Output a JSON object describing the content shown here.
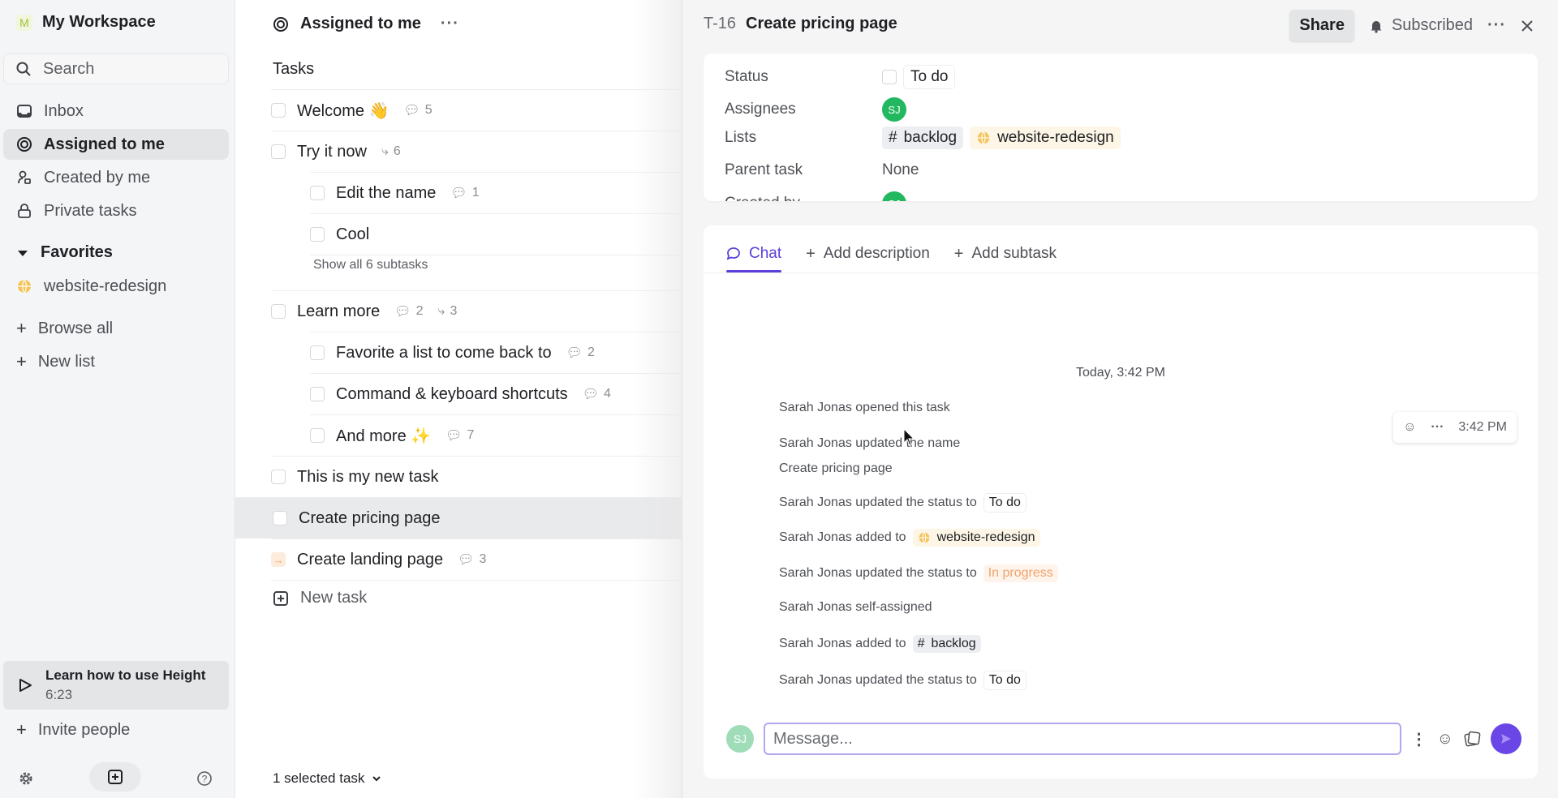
{
  "sidebar": {
    "workspace": {
      "initial": "M",
      "name": "My Workspace"
    },
    "search_placeholder": "Search",
    "items": [
      {
        "label": "Inbox",
        "icon": "inbox-icon"
      },
      {
        "label": "Assigned to me",
        "icon": "target-icon",
        "active": true
      },
      {
        "label": "Created by me",
        "icon": "user-created-icon"
      },
      {
        "label": "Private tasks",
        "icon": "lock-icon"
      }
    ],
    "favorites_label": "Favorites",
    "favorites": [
      {
        "label": "website-redesign",
        "icon": "globe-icon"
      }
    ],
    "browse_all": "Browse all",
    "new_list": "New list",
    "learn": {
      "title": "Learn how to use Height",
      "duration": "6:23"
    },
    "invite": "Invite people"
  },
  "tasks": {
    "header": "Assigned to me",
    "section": "Tasks",
    "rows": [
      {
        "title": "Welcome 👋",
        "comments": "5"
      },
      {
        "title": "Try it now",
        "subtasks": "6"
      },
      {
        "title": "Edit the name",
        "comments": "1"
      },
      {
        "title": "Cool"
      },
      {
        "title": "Learn more",
        "comments": "2",
        "subtasks": "3"
      },
      {
        "title": "Favorite a list to come back to",
        "comments": "2"
      },
      {
        "title": "Command & keyboard shortcuts",
        "comments": "4"
      },
      {
        "title": "And more ✨",
        "comments": "7"
      },
      {
        "title": "This is my new task"
      },
      {
        "title": "Create pricing page",
        "selected": true
      },
      {
        "title": "Create landing page",
        "comments": "3",
        "status": "in-progress"
      }
    ],
    "show_all": "Show all 6 subtasks",
    "new_task": "New task",
    "selected_count": "1 selected task"
  },
  "detail": {
    "id": "T-16",
    "title": "Create pricing page",
    "share": "Share",
    "subscribed": "Subscribed",
    "props": {
      "status_label": "Status",
      "status_value": "To do",
      "assignees_label": "Assignees",
      "assignee_initials": "SJ",
      "lists_label": "Lists",
      "list1": "backlog",
      "list2": "website-redesign",
      "parent_label": "Parent task",
      "parent_value": "None",
      "created_label": "Created by",
      "created_initials": "SJ"
    },
    "tabs": {
      "chat": "Chat",
      "desc": "Add description",
      "subtask": "Add subtask"
    },
    "timeline": {
      "date": "Today, 3:42 PM",
      "hover_time": "3:42 PM",
      "events": [
        {
          "text": "Sarah Jonas opened this task"
        },
        {
          "text": "Sarah Jonas updated the name"
        },
        {
          "text": "Create pricing page"
        },
        {
          "text": "Sarah Jonas updated the status to",
          "chip": "To do"
        },
        {
          "text": "Sarah Jonas added to",
          "chip": "website-redesign"
        },
        {
          "text": "Sarah Jonas updated the status to",
          "chip": "In progress"
        },
        {
          "text": "Sarah Jonas self-assigned"
        },
        {
          "text": "Sarah Jonas added to",
          "chip": "backlog"
        },
        {
          "text": "Sarah Jonas updated the status to",
          "chip": "To do"
        }
      ]
    },
    "composer": {
      "initials": "SJ",
      "placeholder": "Message..."
    }
  },
  "colors": {
    "accent": "#5b3fd8",
    "send": "#6a46e6",
    "avatar": "#22b85f",
    "progress": "#f0a36b"
  }
}
